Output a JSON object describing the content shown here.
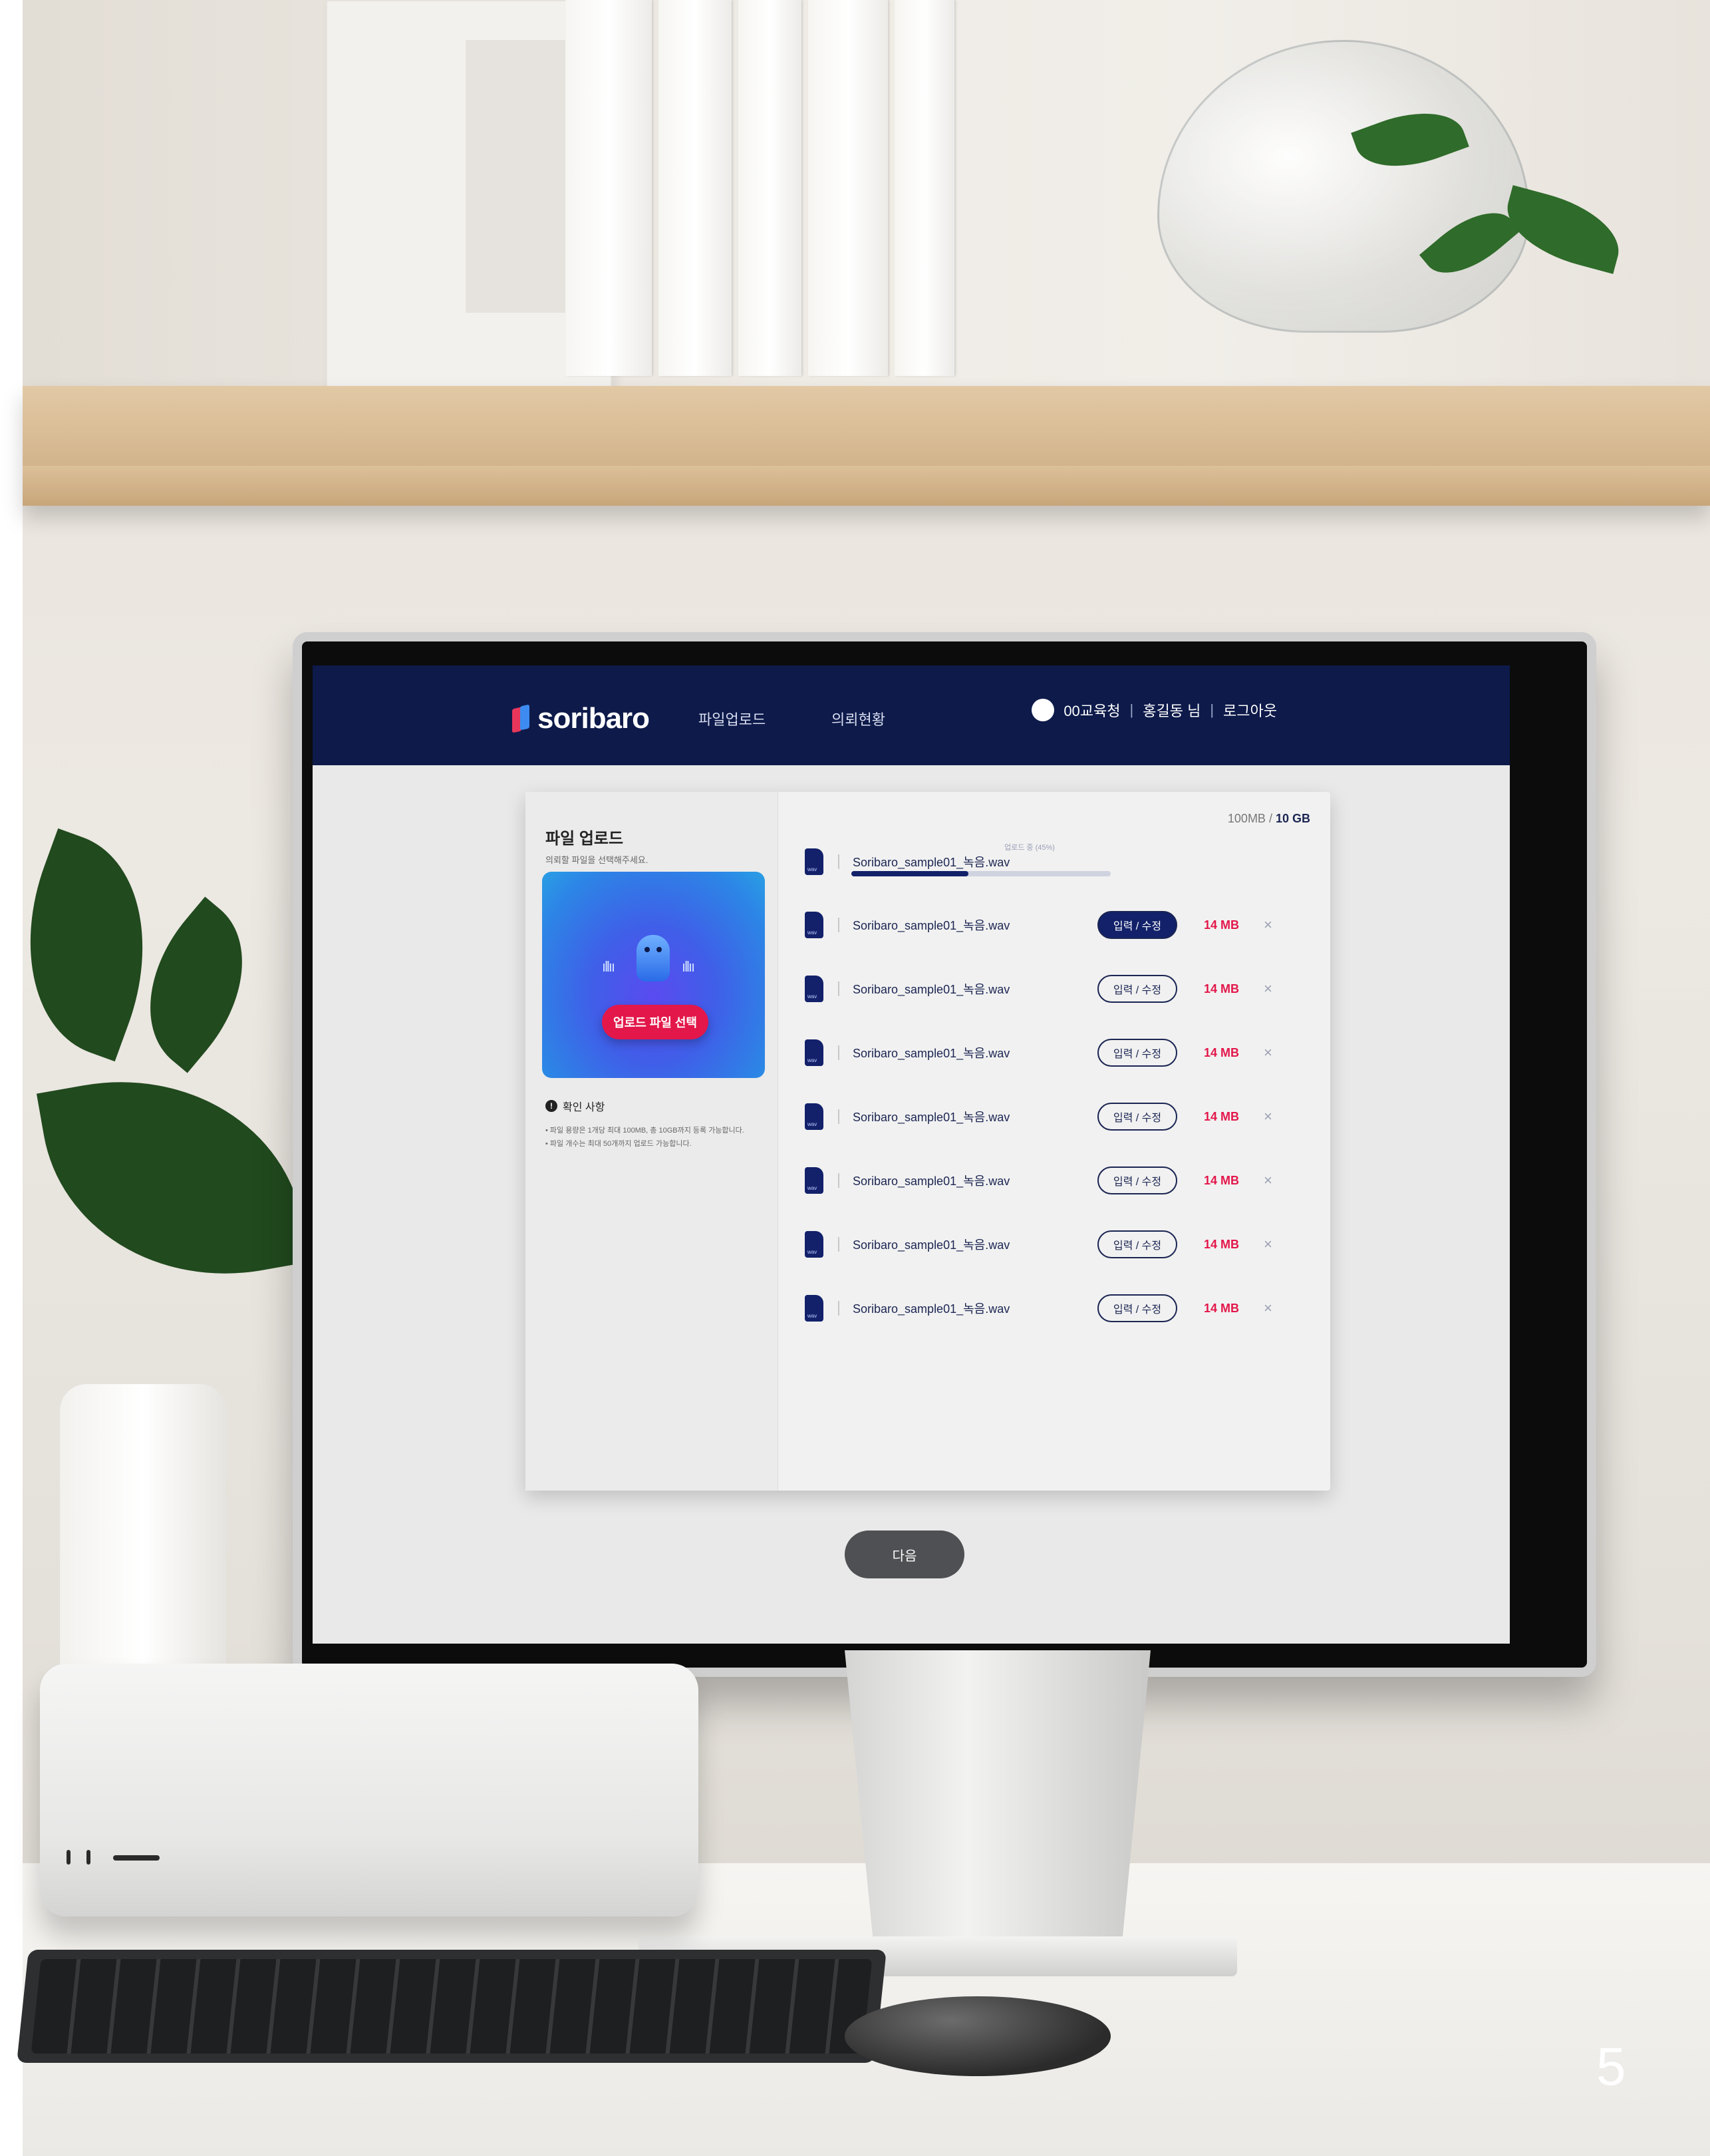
{
  "brand": {
    "name": "soribaro"
  },
  "nav": {
    "items": [
      "파일업로드",
      "의뢰현황"
    ]
  },
  "user": {
    "org": "00교육청",
    "name": "홍길동 님",
    "logout": "로그아웃"
  },
  "upload_panel": {
    "title": "파일 업로드",
    "subtitle": "의뢰할 파일을 선택해주세요.",
    "upload_button": "업로드 파일 선택",
    "notice_title": "확인 사항",
    "notice_lines": [
      "• 파일 용량은 1개당 최대 100MB, 총 10GB까지 등록 가능합니다.",
      "• 파일 개수는 최대 50개까지 업로드 가능합니다."
    ]
  },
  "files": {
    "capacity_used": "100MB",
    "capacity_total": "10 GB",
    "uploading": {
      "name": "Soribaro_sample01_녹음.wav",
      "status": "업로드 중 (45%)",
      "progress": 0.45
    },
    "items": [
      {
        "name": "Soribaro_sample01_녹음.wav",
        "action": "입력 / 수정",
        "size": "14 MB",
        "remove": "×",
        "active": true
      },
      {
        "name": "Soribaro_sample01_녹음.wav",
        "action": "입력 / 수정",
        "size": "14 MB",
        "remove": "×",
        "active": false
      },
      {
        "name": "Soribaro_sample01_녹음.wav",
        "action": "입력 / 수정",
        "size": "14 MB",
        "remove": "×",
        "active": false
      },
      {
        "name": "Soribaro_sample01_녹음.wav",
        "action": "입력 / 수정",
        "size": "14 MB",
        "remove": "×",
        "active": false
      },
      {
        "name": "Soribaro_sample01_녹음.wav",
        "action": "입력 / 수정",
        "size": "14 MB",
        "remove": "×",
        "active": false
      },
      {
        "name": "Soribaro_sample01_녹음.wav",
        "action": "입력 / 수정",
        "size": "14 MB",
        "remove": "×",
        "active": false
      },
      {
        "name": "Soribaro_sample01_녹음.wav",
        "action": "입력 / 수정",
        "size": "14 MB",
        "remove": "×",
        "active": false
      }
    ]
  },
  "footer": {
    "next": "다음"
  },
  "page_number": "5",
  "colors": {
    "nav_bg": "#0d1a4a",
    "accent": "#e3174a",
    "primary": "#12216a"
  }
}
